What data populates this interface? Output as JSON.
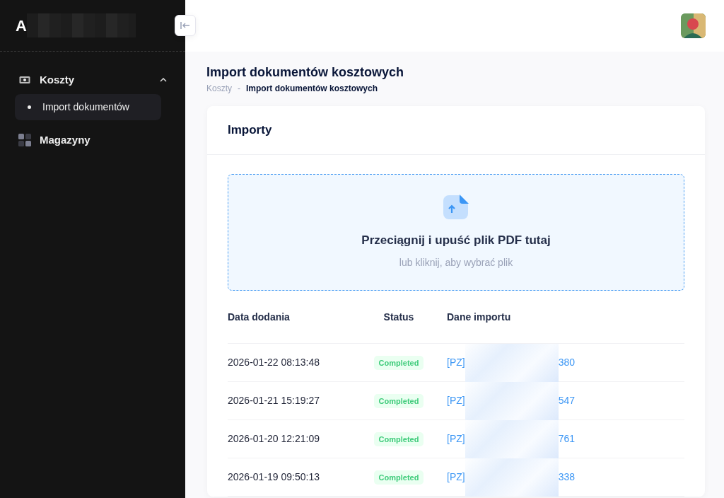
{
  "sidebar": {
    "logo_letter": "A",
    "menu": [
      {
        "label": "Koszty",
        "kind": "money",
        "expanded": true,
        "children": [
          {
            "label": "Import dokumentów",
            "selected": true
          }
        ]
      },
      {
        "label": "Magazyny",
        "kind": "grid",
        "expanded": false
      }
    ]
  },
  "page": {
    "title": "Import dokumentów kosztowych",
    "breadcrumb": [
      {
        "label": "Koszty",
        "current": false
      },
      {
        "label": "Import dokumentów kosztowych",
        "current": true
      }
    ],
    "breadcrumb_separator": "-"
  },
  "card": {
    "title": "Importy",
    "dropzone": {
      "title": "Przeciągnij i upuść plik PDF tutaj",
      "subtitle": "lub kliknij, aby wybrać plik"
    },
    "table": {
      "columns": [
        "Data dodania",
        "Status",
        "Dane importu"
      ],
      "rows": [
        {
          "date": "2026-01-22 08:13:48",
          "status": "Completed",
          "prefix": "[PZ]",
          "suffix": "380"
        },
        {
          "date": "2026-01-21 15:19:27",
          "status": "Completed",
          "prefix": "[PZ]",
          "suffix": "547"
        },
        {
          "date": "2026-01-20 12:21:09",
          "status": "Completed",
          "prefix": "[PZ]",
          "suffix": "761"
        },
        {
          "date": "2026-01-19 09:50:13",
          "status": "Completed",
          "prefix": "[PZ]",
          "suffix": "338"
        }
      ]
    }
  }
}
